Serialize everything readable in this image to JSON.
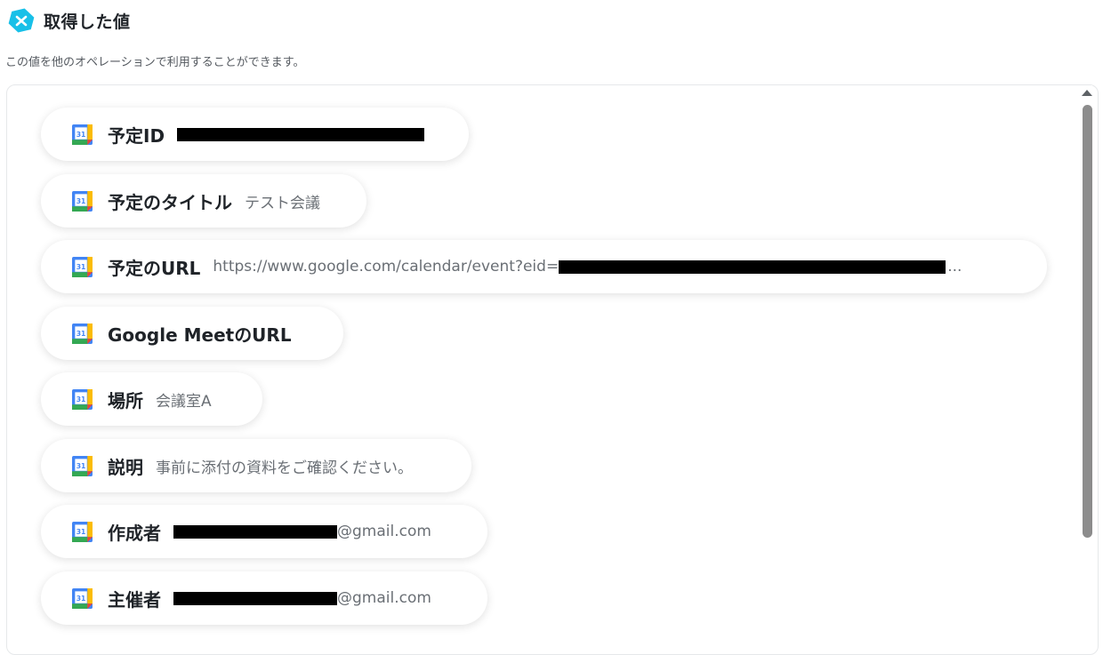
{
  "header": {
    "title": "取得した値",
    "description": "この値を他のオペレーションで利用することができます。"
  },
  "items": [
    {
      "label": "予定ID",
      "value": "",
      "redacted": true,
      "suffix": "",
      "ellipsis": ""
    },
    {
      "label": "予定のタイトル",
      "value": "テスト会議",
      "redacted": false,
      "suffix": "",
      "ellipsis": ""
    },
    {
      "label": "予定のURL",
      "value": "https://www.google.com/calendar/event?eid=",
      "redacted": true,
      "suffix": "",
      "ellipsis": "..."
    },
    {
      "label": "Google MeetのURL",
      "value": "",
      "redacted": false,
      "suffix": "",
      "ellipsis": ""
    },
    {
      "label": "場所",
      "value": "会議室A",
      "redacted": false,
      "suffix": "",
      "ellipsis": ""
    },
    {
      "label": "説明",
      "value": "事前に添付の資料をご確認ください。",
      "redacted": false,
      "suffix": "",
      "ellipsis": ""
    },
    {
      "label": "作成者",
      "value": "",
      "redacted": true,
      "suffix": "@gmail.com",
      "ellipsis": ""
    },
    {
      "label": "主催者",
      "value": "",
      "redacted": true,
      "suffix": "@gmail.com",
      "ellipsis": ""
    }
  ],
  "icons": {
    "logo": "yoom-logo-icon",
    "item_icon": "google-calendar-icon",
    "calendar_day": "31"
  },
  "colors": {
    "logo_bg": "#18c0e8",
    "text": "#1f2328",
    "value_text": "#6a6f75",
    "scrollbar": "#8c8c8c"
  }
}
